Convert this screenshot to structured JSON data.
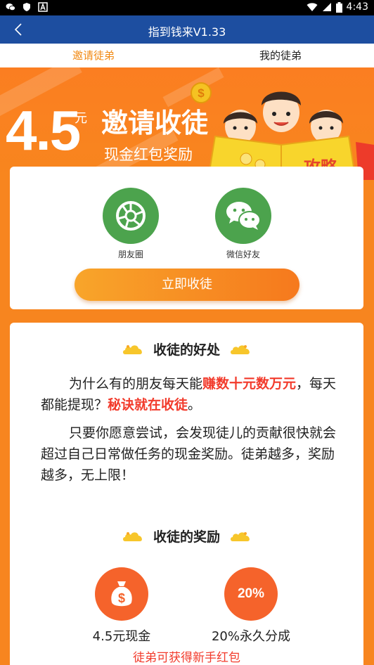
{
  "status_bar": {
    "time": "4:43",
    "icons": [
      "wechat-icon",
      "shield-icon",
      "a-icon",
      "wifi-icon",
      "signal-icon",
      "battery-icon"
    ]
  },
  "header": {
    "title": "指到钱来V1.33",
    "back_icon": "chevron-left-icon"
  },
  "tabs": [
    {
      "label": "邀请徒弟",
      "active": true
    },
    {
      "label": "我的徒弟",
      "active": false
    }
  ],
  "banner": {
    "amount": "4.5",
    "unit": "元",
    "title": "邀请收徒",
    "subtitle": "现金红包奖励",
    "tag": "攻略"
  },
  "share": {
    "options": [
      {
        "label": "朋友圈",
        "icon": "moments-icon"
      },
      {
        "label": "微信好友",
        "icon": "wechat-friends-icon"
      }
    ],
    "cta": "立即收徒"
  },
  "benefits": {
    "title": "收徒的好处",
    "p1": {
      "a": "为什么有的朋友每天能",
      "b": "赚数十元数万元",
      "c": "，每天都能提现？",
      "d": "秘诀就在收徒",
      "e": "。"
    },
    "p2": "只要你愿意尝试，会发现徒儿的贡献很快就会超过自己日常做任务的现金奖励。徒弟越多，奖励越多，无上限！"
  },
  "rewards": {
    "title": "收徒的奖励",
    "items": [
      {
        "label": "4.5元现金",
        "icon": "money-bag-icon",
        "badge": ""
      },
      {
        "label": "20%永久分成",
        "icon": "",
        "badge": "20%"
      }
    ],
    "note": "徒弟可获得新手红包"
  },
  "colors": {
    "header": "#1d4ea0",
    "accent": "#f18a14",
    "banner": "#f8861e",
    "share_green": "#4ca34d",
    "reward_orange": "#f5632b",
    "highlight_red": "#f23b2c"
  }
}
